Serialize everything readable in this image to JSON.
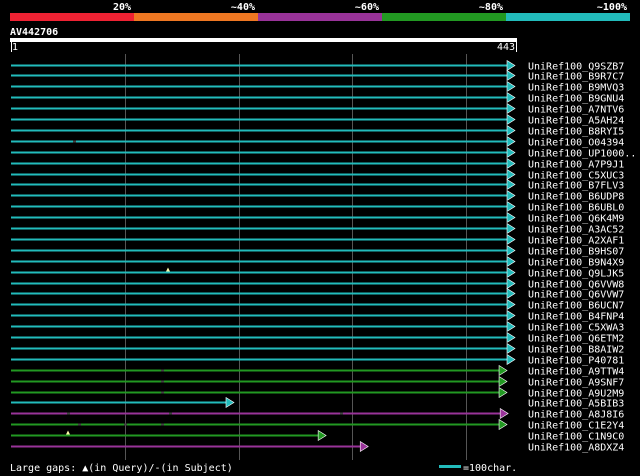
{
  "scale": {
    "labels": [
      "20%",
      "~40%",
      "~60%",
      "~80%",
      "~100%"
    ],
    "colors": [
      "#ee2233",
      "#ee7722",
      "#993399",
      "#229922",
      "#22bbbb"
    ]
  },
  "query": {
    "name": "AV442706",
    "start_label": "1",
    "end_label": "443"
  },
  "hits": [
    {
      "id": "UniRef100_Q9SZB7",
      "color": "#22bbbb",
      "end": 443,
      "arrow": true,
      "marks": []
    },
    {
      "id": "UniRef100_B9R7C7",
      "color": "#22bbbb",
      "end": 443,
      "arrow": true,
      "marks": []
    },
    {
      "id": "UniRef100_B9MVQ3",
      "color": "#22bbbb",
      "end": 443,
      "arrow": true,
      "marks": []
    },
    {
      "id": "UniRef100_B9GNU4",
      "color": "#22bbbb",
      "end": 443,
      "arrow": true,
      "marks": []
    },
    {
      "id": "UniRef100_A7NTV6",
      "color": "#22bbbb",
      "end": 443,
      "arrow": true,
      "marks": []
    },
    {
      "id": "UniRef100_A5AH24",
      "color": "#22bbbb",
      "end": 443,
      "arrow": true,
      "marks": []
    },
    {
      "id": "UniRef100_B8RYI5",
      "color": "#22bbbb",
      "end": 443,
      "arrow": true,
      "marks": []
    },
    {
      "id": "UniRef100_O04394",
      "color": "#22bbbb",
      "end": 443,
      "arrow": true,
      "marks": [
        {
          "pos": 55,
          "type": "subject"
        }
      ]
    },
    {
      "id": "UniRef100_UP1000..",
      "color": "#22bbbb",
      "end": 443,
      "arrow": true,
      "marks": []
    },
    {
      "id": "UniRef100_A7P9J1",
      "color": "#22bbbb",
      "end": 443,
      "arrow": true,
      "marks": []
    },
    {
      "id": "UniRef100_C5XUC3",
      "color": "#22bbbb",
      "end": 443,
      "arrow": true,
      "marks": []
    },
    {
      "id": "UniRef100_B7FLV3",
      "color": "#22bbbb",
      "end": 443,
      "arrow": true,
      "marks": []
    },
    {
      "id": "UniRef100_B6UDP8",
      "color": "#22bbbb",
      "end": 443,
      "arrow": true,
      "marks": []
    },
    {
      "id": "UniRef100_B6UBL0",
      "color": "#22bbbb",
      "end": 443,
      "arrow": true,
      "marks": []
    },
    {
      "id": "UniRef100_Q6K4M9",
      "color": "#22bbbb",
      "end": 443,
      "arrow": true,
      "marks": []
    },
    {
      "id": "UniRef100_A3AC52",
      "color": "#22bbbb",
      "end": 443,
      "arrow": true,
      "marks": []
    },
    {
      "id": "UniRef100_A2XAF1",
      "color": "#22bbbb",
      "end": 443,
      "arrow": true,
      "marks": []
    },
    {
      "id": "UniRef100_B9HS07",
      "color": "#22bbbb",
      "end": 443,
      "arrow": true,
      "marks": []
    },
    {
      "id": "UniRef100_B9N4X9",
      "color": "#22bbbb",
      "end": 443,
      "arrow": true,
      "marks": []
    },
    {
      "id": "UniRef100_Q9LJK5",
      "color": "#22bbbb",
      "end": 443,
      "arrow": true,
      "marks": [
        {
          "pos": 138,
          "type": "query"
        }
      ]
    },
    {
      "id": "UniRef100_Q6VVW8",
      "color": "#22bbbb",
      "end": 443,
      "arrow": true,
      "marks": []
    },
    {
      "id": "UniRef100_Q6VVW7",
      "color": "#22bbbb",
      "end": 443,
      "arrow": true,
      "marks": []
    },
    {
      "id": "UniRef100_B6UCN7",
      "color": "#22bbbb",
      "end": 443,
      "arrow": true,
      "marks": []
    },
    {
      "id": "UniRef100_B4FNP4",
      "color": "#22bbbb",
      "end": 443,
      "arrow": true,
      "marks": []
    },
    {
      "id": "UniRef100_C5XWA3",
      "color": "#22bbbb",
      "end": 443,
      "arrow": true,
      "marks": []
    },
    {
      "id": "UniRef100_Q6ETM2",
      "color": "#22bbbb",
      "end": 443,
      "arrow": true,
      "marks": []
    },
    {
      "id": "UniRef100_B8AIW2",
      "color": "#22bbbb",
      "end": 443,
      "arrow": true,
      "marks": []
    },
    {
      "id": "UniRef100_P40781",
      "color": "#22bbbb",
      "end": 443,
      "arrow": true,
      "marks": []
    },
    {
      "id": "UniRef100_A9TTW4",
      "color": "#229922",
      "end": 436,
      "arrow": true,
      "marks": [
        {
          "pos": 133,
          "type": "subject"
        }
      ]
    },
    {
      "id": "UniRef100_A9SNF7",
      "color": "#229922",
      "end": 436,
      "arrow": true,
      "marks": [
        {
          "pos": 133,
          "type": "subject"
        }
      ]
    },
    {
      "id": "UniRef100_A9U2M9",
      "color": "#229922",
      "end": 436,
      "arrow": true,
      "marks": [
        {
          "pos": 133,
          "type": "subject"
        }
      ]
    },
    {
      "id": "UniRef100_A5BIB3",
      "color": "#22bbbb",
      "end": 196,
      "arrow": true,
      "marks": []
    },
    {
      "id": "UniRef100_A8J8I6",
      "color": "#993399",
      "end": 437,
      "arrow": true,
      "marks": [
        {
          "pos": 50,
          "type": "subject"
        },
        {
          "pos": 140,
          "type": "subject"
        },
        {
          "pos": 290,
          "type": "subject"
        }
      ]
    },
    {
      "id": "UniRef100_C1E2Y4",
      "color": "#229922",
      "end": 436,
      "arrow": true,
      "marks": [
        {
          "pos": 60,
          "type": "subject"
        },
        {
          "pos": 100,
          "type": "subject"
        },
        {
          "pos": 133,
          "type": "subject"
        }
      ]
    },
    {
      "id": "UniRef100_C1N9C0",
      "color": "#229922",
      "end": 277,
      "arrow": true,
      "marks": [
        {
          "pos": 50,
          "type": "query"
        }
      ]
    },
    {
      "id": "UniRef100_A8DXZ4",
      "color": "#993399",
      "end": 314,
      "arrow": true,
      "marks": []
    }
  ],
  "legend": {
    "gaps_text": "Large gaps: ▲(in Query)/‐(in Subject)",
    "scale_text": "=100char.",
    "scale_color": "#22bbbb"
  }
}
